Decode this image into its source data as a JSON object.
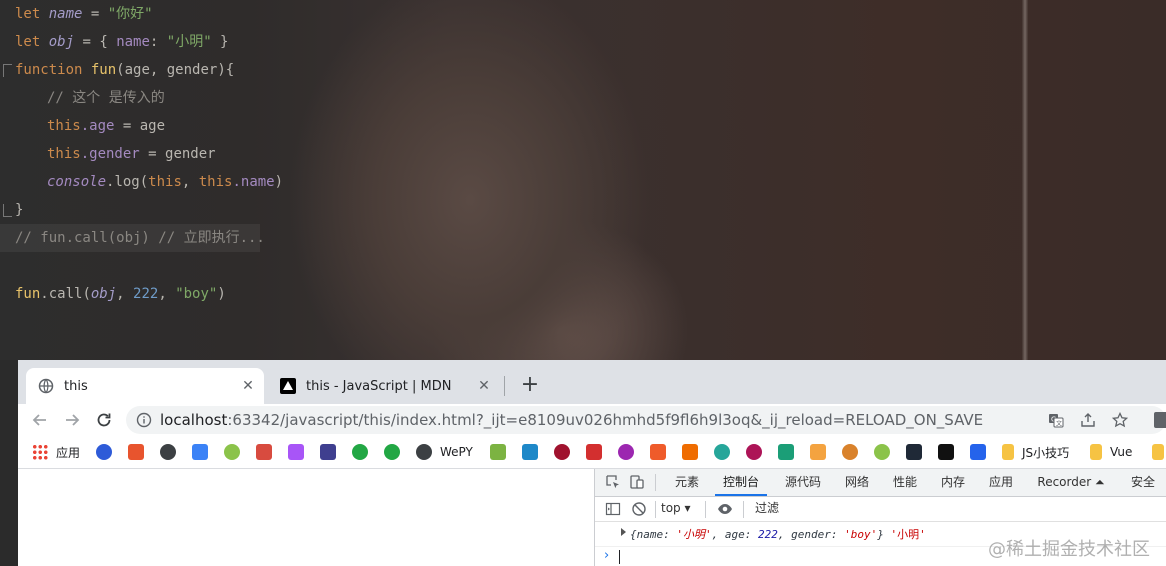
{
  "editor": {
    "line1": {
      "kw": "let",
      "name": "name",
      "eq": " = ",
      "str": "\"你好\""
    },
    "line2": {
      "kw": "let",
      "name": "obj",
      "eq": " = { ",
      "key": "name",
      "colon": ": ",
      "str": "\"小明\"",
      "end": " }"
    },
    "line3": {
      "kw": "function",
      "fn": "fun",
      "params": "(age, gender){"
    },
    "line4": {
      "comment": "// 这个 是传入的"
    },
    "line5": {
      "this": "this",
      "prop": ".age",
      "rest": " = age"
    },
    "line6": {
      "this": "this",
      "prop": ".gender",
      "rest": " = gender"
    },
    "line7": {
      "console": "console",
      "method": ".log(",
      "this1": "this",
      "mid": ", ",
      "this2": "this",
      "prop": ".name",
      "end": ")"
    },
    "line8": {
      "brace": "}"
    },
    "line9": {
      "comment": "// fun.call(obj) // 立即执行..."
    },
    "line10": {
      "fn": "fun",
      "call": ".call(",
      "obj": "obj",
      "c1": ", ",
      "num": "222",
      "c2": ", ",
      "str": "\"boy\"",
      "end": ")"
    }
  },
  "browser": {
    "tabs": [
      {
        "title": "this",
        "icon": "globe-icon"
      },
      {
        "title": "this - JavaScript | MDN",
        "icon": "mdn-icon"
      }
    ],
    "close_glyph": "✕",
    "newtab_glyph": "+",
    "url": {
      "host": "localhost",
      "rest": ":63342/javascript/this/index.html?_ijt=e8109uv026hmhd5f9fl6h9l3oq&_ij_reload=RELOAD_ON_SAVE"
    },
    "bookmarks": [
      {
        "label": "应用",
        "color": "#4285f4"
      },
      {
        "label": "",
        "color": "#2e5bd8"
      },
      {
        "label": "",
        "color": "#e8542e"
      },
      {
        "label": "",
        "color": "#3c4043"
      },
      {
        "label": "",
        "color": "#3b82f6"
      },
      {
        "label": "",
        "color": "#8bc34a"
      },
      {
        "label": "",
        "color": "#d84b3f"
      },
      {
        "label": "",
        "color": "#a855f7"
      },
      {
        "label": "",
        "color": "#3f3f8f"
      },
      {
        "label": "",
        "color": "#22a744"
      },
      {
        "label": "",
        "color": "#22a744"
      },
      {
        "label": "WePY",
        "color": "#3c4043"
      },
      {
        "label": "",
        "color": "#7cb342"
      },
      {
        "label": "",
        "color": "#1e88c8"
      },
      {
        "label": "",
        "color": "#a0122e"
      },
      {
        "label": "",
        "color": "#d32f2f"
      },
      {
        "label": "",
        "color": "#9c27b0"
      },
      {
        "label": "",
        "color": "#ef5b2a"
      },
      {
        "label": "",
        "color": "#ef6c00"
      },
      {
        "label": "",
        "color": "#26a69a"
      },
      {
        "label": "",
        "color": "#ad1457"
      },
      {
        "label": "",
        "color": "#1b9e77"
      },
      {
        "label": "",
        "color": "#f4a340"
      },
      {
        "label": "",
        "color": "#d9822b"
      },
      {
        "label": "",
        "color": "#8bc34a"
      },
      {
        "label": "",
        "color": "#1f2937"
      },
      {
        "label": "",
        "color": "#111111"
      },
      {
        "label": "",
        "color": "#2563eb"
      },
      {
        "label": "JS小技巧",
        "color": "#f6c343"
      },
      {
        "label": "Vue",
        "color": "#f6c343"
      }
    ]
  },
  "devtools": {
    "tabs": [
      "元素",
      "控制台",
      "源代码",
      "网络",
      "性能",
      "内存",
      "应用",
      "Recorder ⏶",
      "安全"
    ],
    "active_tab": "控制台",
    "context": "top",
    "filter_placeholder": "过滤",
    "log": {
      "open": "{",
      "k1": "name",
      "v1": "'小明'",
      "k2": "age",
      "v2": "222",
      "k3": "gender",
      "v3": "'boy'",
      "close": "}",
      "extra": "'小明'"
    }
  },
  "watermark": "@稀土掘金技术社区"
}
